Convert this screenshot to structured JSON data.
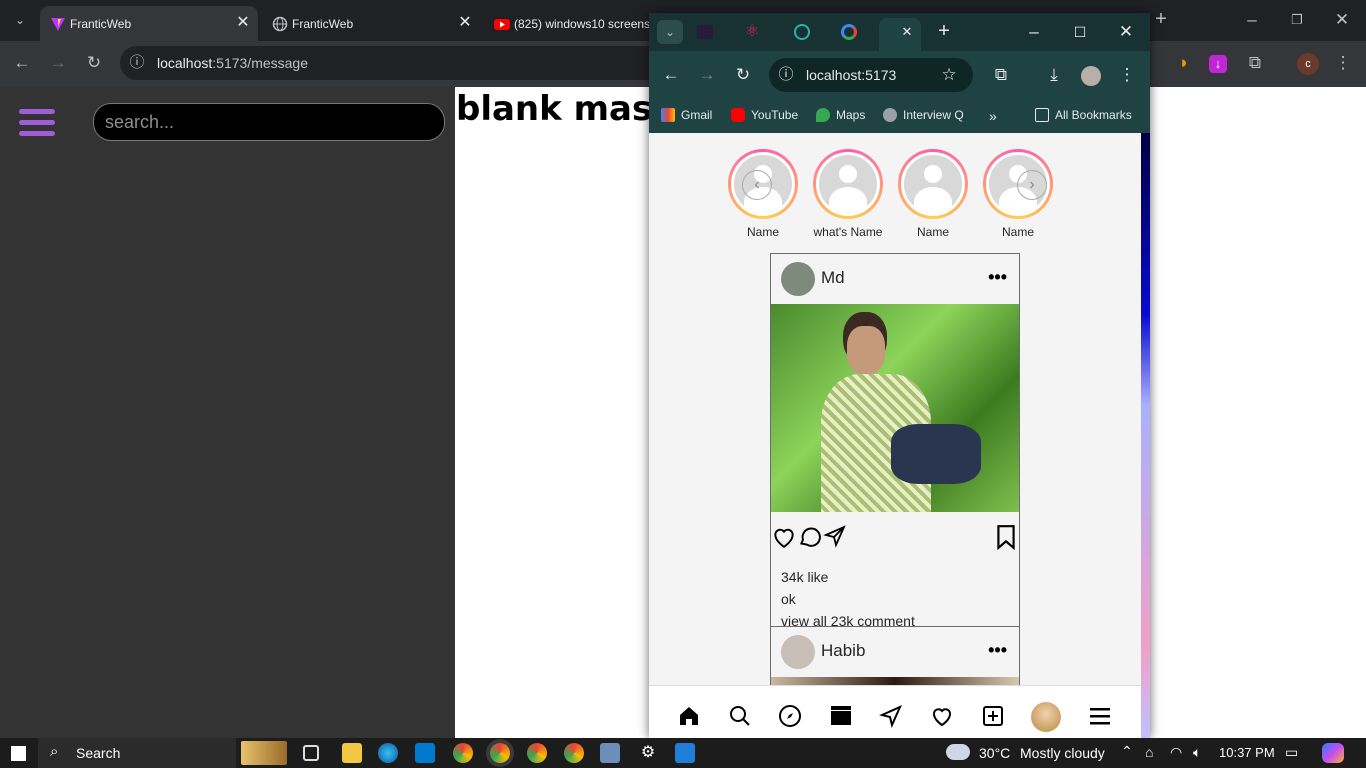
{
  "back_window": {
    "tabs": [
      {
        "title": "FranticWeb",
        "active": true
      },
      {
        "title": "FranticWeb",
        "active": false
      },
      {
        "title": "(825) windows10 screens",
        "active": false
      }
    ],
    "url_host": "localhost",
    "url_rest": ":5173/message",
    "new_tab_glyph": "+"
  },
  "page": {
    "search_placeholder": "search...",
    "heading": "blank massage"
  },
  "popup": {
    "url": "localhost:5173",
    "bookmarks": [
      "Gmail",
      "YouTube",
      "Maps",
      "Interview Q",
      "All Bookmarks"
    ],
    "stories": [
      "Name",
      "what's Name",
      "Name",
      "Name"
    ],
    "posts": [
      {
        "user": "Md",
        "likes": "34k like",
        "caption": "ok",
        "comments": "view all 23k comment"
      },
      {
        "user": "Habib"
      }
    ]
  },
  "taskbar": {
    "search_label": "Search",
    "weather": "30°C",
    "weather_desc": "Mostly cloudy",
    "time": "10:37 PM"
  },
  "colors": {
    "accent": "#a15cd9",
    "popup_frame": "#1f4243"
  }
}
